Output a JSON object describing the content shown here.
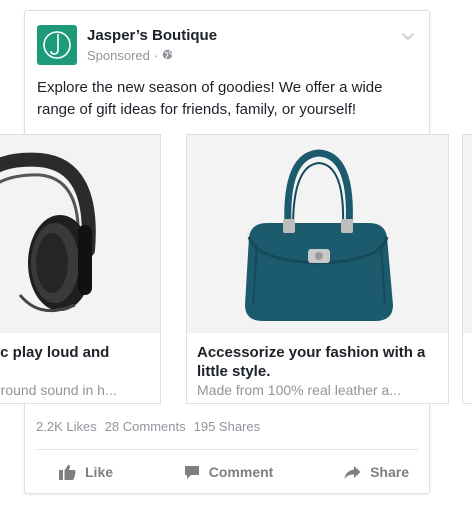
{
  "post": {
    "page_name": "Jasper’s Boutique",
    "sponsored": "Sponsored",
    "meta_separator": "·",
    "text": "Explore the new season of goodies! We offer a wide range of gift ideas for friends, family, or yourself!"
  },
  "carousel": {
    "cards": [
      {
        "title": "ic play loud and",
        "description": "rround sound in h..."
      },
      {
        "title": "Accessorize your fashion with a little style.",
        "description": "Made from 100% real leather a..."
      }
    ]
  },
  "stats": {
    "likes": "2.2K Likes",
    "comments": "28 Comments",
    "shares": "195 Shares"
  },
  "actions": {
    "like": "Like",
    "comment": "Comment",
    "share": "Share"
  },
  "colors": {
    "brand": "#1d9a7a",
    "bag": "#1c5a6e",
    "muted": "#90949c"
  },
  "icons": [
    "logo-icon",
    "globe-icon",
    "chevron-down-icon",
    "thumbs-up-icon",
    "comment-icon",
    "share-icon"
  ]
}
